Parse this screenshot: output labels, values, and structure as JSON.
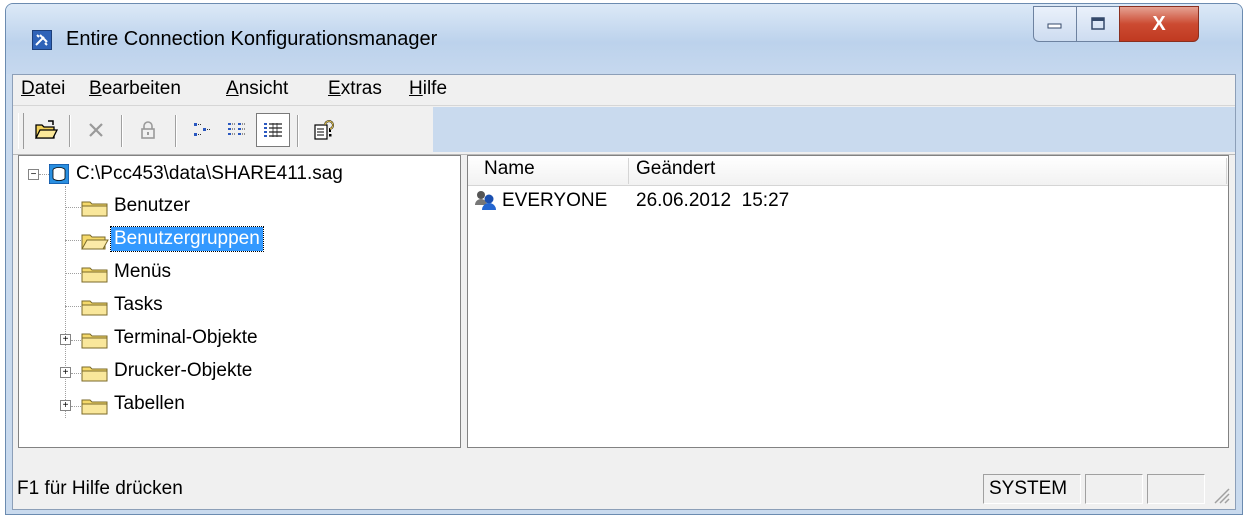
{
  "window": {
    "title": "Entire Connection Konfigurationsmanager",
    "buttons": {
      "minimize_icon": "minimize-icon",
      "maximize_icon": "maximize-icon",
      "close_label": "X"
    }
  },
  "menubar": {
    "items": [
      {
        "pre": "",
        "u": "D",
        "post": "atei"
      },
      {
        "pre": "",
        "u": "B",
        "post": "earbeiten"
      },
      {
        "pre": "",
        "u": "A",
        "post": "nsicht"
      },
      {
        "pre": "",
        "u": "E",
        "post": "xtras"
      },
      {
        "pre": "",
        "u": "H",
        "post": "ilfe"
      }
    ]
  },
  "toolbar": {
    "icons": [
      "open-folder-icon",
      "delete-icon",
      "lock-icon",
      "small-icons-view-icon",
      "list-view-icon",
      "details-view-icon",
      "help-context-icon"
    ]
  },
  "tree": {
    "root": {
      "label": "C:\\Pcc453\\data\\SHARE411.sag",
      "expanded": true
    },
    "items": [
      {
        "label": "Benutzer",
        "expandable": false,
        "selected": false,
        "open": false
      },
      {
        "label": "Benutzergruppen",
        "expandable": false,
        "selected": true,
        "open": true
      },
      {
        "label": "Menüs",
        "expandable": false,
        "selected": false,
        "open": false
      },
      {
        "label": "Tasks",
        "expandable": false,
        "selected": false,
        "open": false
      },
      {
        "label": "Terminal-Objekte",
        "expandable": true,
        "selected": false,
        "open": false
      },
      {
        "label": "Drucker-Objekte",
        "expandable": true,
        "selected": false,
        "open": false
      },
      {
        "label": "Tabellen",
        "expandable": true,
        "selected": false,
        "open": false
      }
    ]
  },
  "list": {
    "columns": [
      "Name",
      "Geändert"
    ],
    "rows": [
      {
        "name": "EVERYONE",
        "changed": "26.06.2012  15:27",
        "icon": "user-group-icon"
      }
    ]
  },
  "statusbar": {
    "help_text": "F1 für Hilfe drücken",
    "panels": [
      "SYSTEM",
      "",
      ""
    ]
  },
  "colors": {
    "selection": "#3399ff",
    "titlebar": "#c9daee",
    "close_button": "#c9452d",
    "folder": "#f5d96b"
  }
}
